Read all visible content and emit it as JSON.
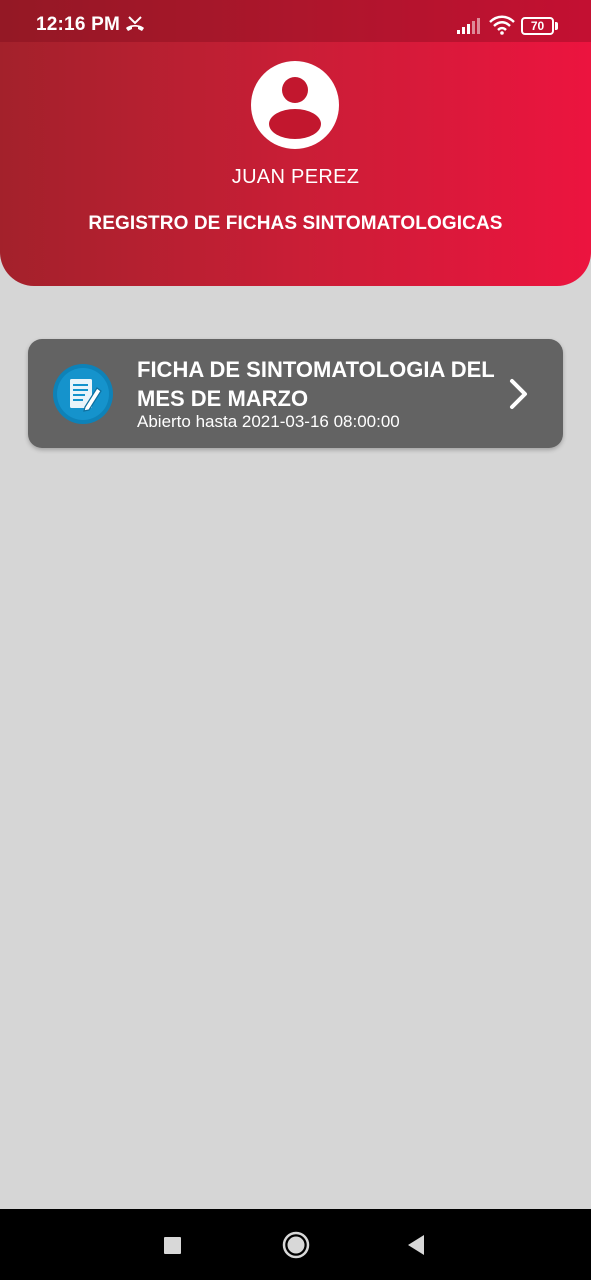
{
  "status_bar": {
    "time": "12:16 PM",
    "battery_level": "70",
    "icons": [
      "missed-call-icon",
      "signal-icon",
      "wifi-icon",
      "battery-icon"
    ]
  },
  "header": {
    "user_name": "JUAN PEREZ",
    "section_title": "REGISTRO DE FICHAS SINTOMATOLOGICAS",
    "gradient_colors": [
      "#a3212b",
      "#ec143f"
    ]
  },
  "forms": [
    {
      "title": "FICHA DE SINTOMATOLOGIA DEL MES DE MARZO",
      "subtitle": "Abierto hasta 2021-03-16 08:00:00",
      "icon": "document-edit-icon",
      "card_color": "#636363"
    }
  ],
  "background_color": "#d6d6d6",
  "nav_bar": {
    "buttons": [
      "recents-button",
      "home-button",
      "back-button"
    ]
  }
}
